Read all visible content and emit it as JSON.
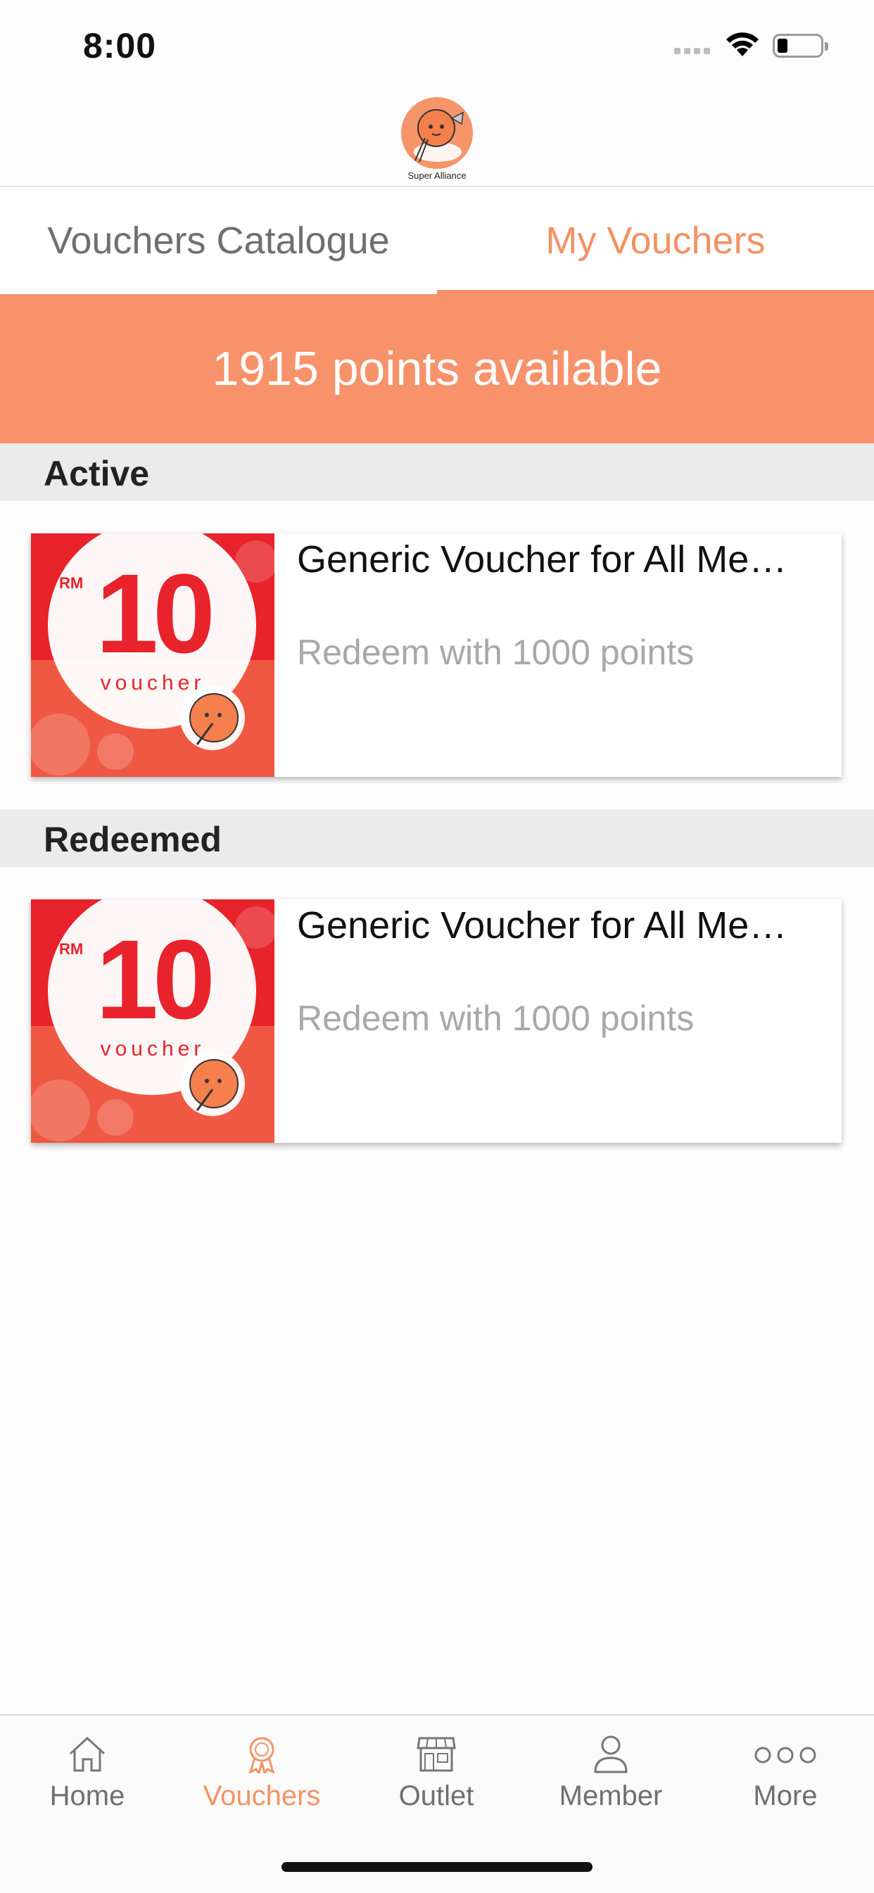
{
  "status_bar": {
    "time": "8:00"
  },
  "header": {
    "logo_caption": "Super Alliance"
  },
  "tabs": [
    {
      "label": "Vouchers Catalogue",
      "active": false
    },
    {
      "label": "My Vouchers",
      "active": true
    }
  ],
  "points_banner": {
    "text": "1915 points available"
  },
  "sections": {
    "active": {
      "title": "Active",
      "vouchers": [
        {
          "title": "Generic Voucher for All Me…",
          "subtitle": "Redeem with 1000 points",
          "image": {
            "currency": "RM",
            "amount": "10",
            "word": "voucher"
          }
        }
      ]
    },
    "redeemed": {
      "title": "Redeemed",
      "vouchers": [
        {
          "title": "Generic Voucher for All Me…",
          "subtitle": "Redeem with 1000 points",
          "image": {
            "currency": "RM",
            "amount": "10",
            "word": "voucher"
          }
        }
      ]
    }
  },
  "tabbar": {
    "items": [
      {
        "label": "Home",
        "icon": "home-icon",
        "active": false
      },
      {
        "label": "Vouchers",
        "icon": "voucher-badge-icon",
        "active": true
      },
      {
        "label": "Outlet",
        "icon": "store-icon",
        "active": false
      },
      {
        "label": "Member",
        "icon": "person-icon",
        "active": false
      },
      {
        "label": "More",
        "icon": "more-dots-icon",
        "active": false
      }
    ]
  },
  "colors": {
    "accent": "#f8926a",
    "accent_text": "#f39265",
    "voucher_red": "#e8232b",
    "section_bg": "#ebebeb"
  }
}
